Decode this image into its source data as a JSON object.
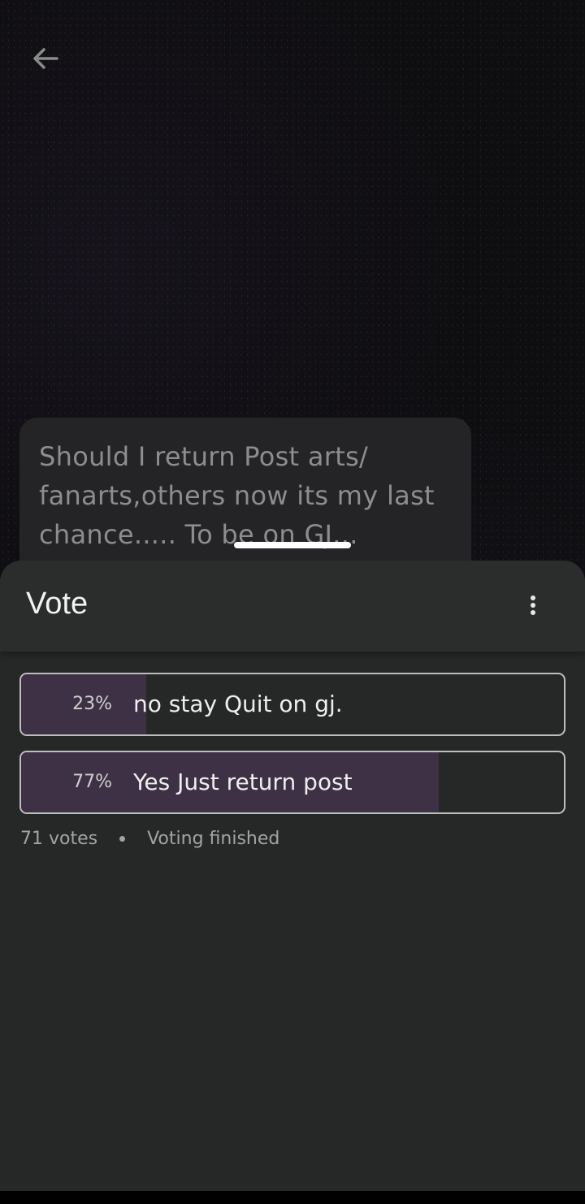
{
  "post": {
    "text": "Should I return Post arts/\nfanarts,others now its my last\nchance..... To be on GJ..."
  },
  "sheet": {
    "title": "Vote"
  },
  "poll": {
    "options": [
      {
        "percent": "23%",
        "label": "no stay Quit on gj.",
        "share": 0.23
      },
      {
        "percent": "77%",
        "label": "Yes Just return post",
        "share": 0.77
      }
    ],
    "votes": "71 votes",
    "status": "Voting finished"
  },
  "icons": {
    "back": "arrow-left-icon",
    "more": "more-vertical-icon"
  },
  "colors": {
    "sheet_background": "#262828",
    "bar_fill": "#3f3145",
    "option_border": "#bdbdbd"
  }
}
